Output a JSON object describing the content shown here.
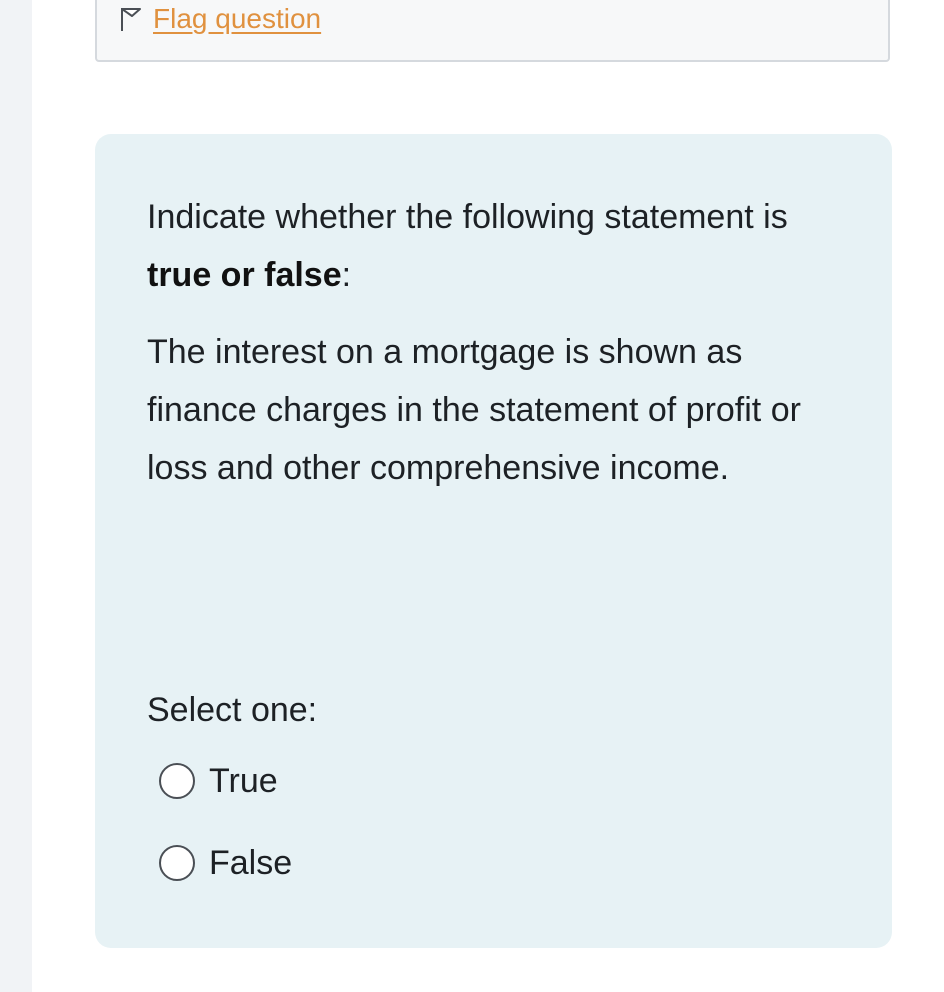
{
  "flag": {
    "label": "Flag question",
    "icon": "flag-outline-icon"
  },
  "question": {
    "instruction_prefix": "Indicate whether the following statement is ",
    "instruction_bold": "true or false",
    "instruction_suffix": ":",
    "statement": "The interest on a mortgage is shown as finance charges in the statement of profit or loss and other comprehensive income.",
    "prompt": "Select one:",
    "options": [
      {
        "label": "True",
        "selected": false
      },
      {
        "label": "False",
        "selected": false
      }
    ]
  },
  "colors": {
    "link": "#e0913f",
    "card_background": "#e7f2f5",
    "text": "#1d2125"
  }
}
